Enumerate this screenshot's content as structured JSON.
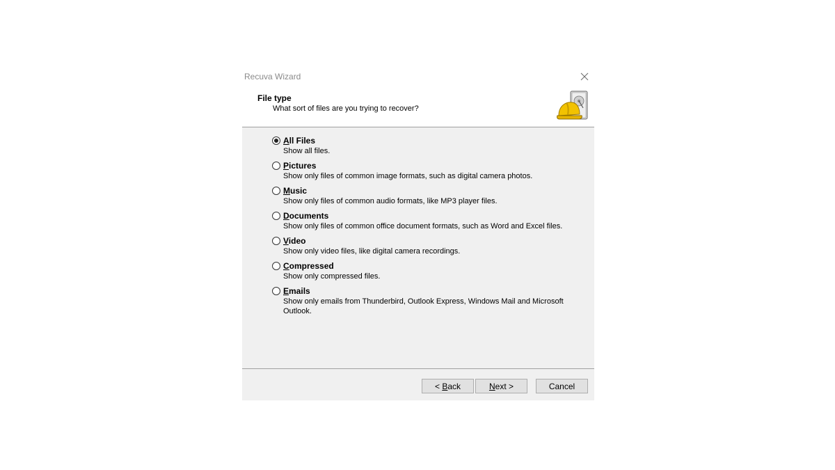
{
  "window": {
    "title": "Recuva Wizard"
  },
  "header": {
    "title": "File type",
    "subtitle": "What sort of files are you trying to recover?"
  },
  "options": [
    {
      "label_access": "A",
      "label_rest": "ll Files",
      "description": "Show all files.",
      "selected": true
    },
    {
      "label_access": "P",
      "label_rest": "ictures",
      "description": "Show only files of common image formats, such as digital camera photos.",
      "selected": false
    },
    {
      "label_access": "M",
      "label_rest": "usic",
      "description": "Show only files of common audio formats, like MP3 player files.",
      "selected": false
    },
    {
      "label_access": "D",
      "label_rest": "ocuments",
      "description": "Show only files of common office document formats, such as Word and Excel files.",
      "selected": false
    },
    {
      "label_access": "V",
      "label_rest": "ideo",
      "description": "Show only video files, like digital camera recordings.",
      "selected": false
    },
    {
      "label_access": "C",
      "label_rest": "ompressed",
      "description": "Show only compressed files.",
      "selected": false
    },
    {
      "label_access": "E",
      "label_rest": "mails",
      "description": "Show only emails from Thunderbird, Outlook Express, Windows Mail and Microsoft Outlook.",
      "selected": false
    }
  ],
  "footer": {
    "back_prefix": "< ",
    "back_access": "B",
    "back_rest": "ack",
    "next_access": "N",
    "next_rest": "ext >",
    "cancel_label": "Cancel"
  },
  "colors": {
    "content_bg": "#f0f0f0",
    "button_bg": "#e1e1e1",
    "icon_yellow": "#f2c200"
  },
  "icons": {
    "close": "close-icon",
    "header": "hard-drive-helmet-icon"
  }
}
